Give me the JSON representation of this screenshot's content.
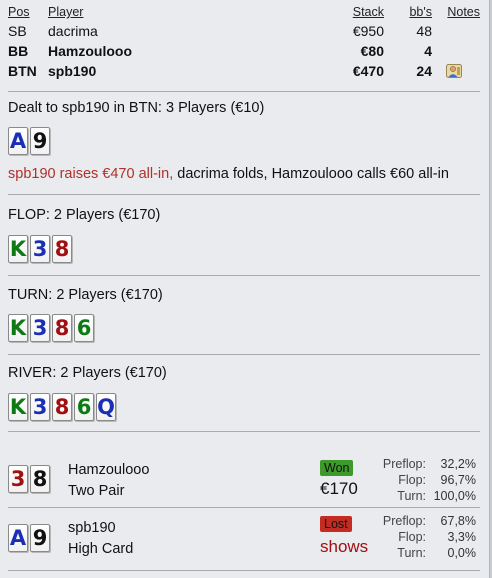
{
  "players": {
    "headers": {
      "pos": "Pos",
      "player": "Player",
      "stack": "Stack",
      "bbs": "bb's",
      "notes": "Notes"
    },
    "rows": [
      {
        "pos": "SB",
        "player": "dacrima",
        "stack": "€950",
        "bbs": "48"
      },
      {
        "pos": "BB",
        "player": "Hamzoulooo",
        "stack": "€80",
        "bbs": "4"
      },
      {
        "pos": "BTN",
        "player": "spb190",
        "stack": "€470",
        "bbs": "24",
        "notes_icon": "notes-user-icon"
      }
    ]
  },
  "preflop": {
    "title": "Dealt to spb190 in BTN: 3 Players (€10)",
    "cards": [
      {
        "rank": "A",
        "suit": "diamonds"
      },
      {
        "rank": "9",
        "suit": "spades"
      }
    ],
    "action_raise": "spb190 raises €470 all-in,",
    "action_rest": " dacrima folds, Hamzoulooo calls €60 all-in"
  },
  "flop": {
    "title": "FLOP: 2 Players (€170)",
    "cards": [
      {
        "rank": "K",
        "suit": "clubs"
      },
      {
        "rank": "3",
        "suit": "diamonds"
      },
      {
        "rank": "8",
        "suit": "hearts"
      }
    ]
  },
  "turn": {
    "title": "TURN: 2 Players (€170)",
    "cards": [
      {
        "rank": "K",
        "suit": "clubs"
      },
      {
        "rank": "3",
        "suit": "diamonds"
      },
      {
        "rank": "8",
        "suit": "hearts"
      },
      {
        "rank": "6",
        "suit": "clubs"
      }
    ]
  },
  "river": {
    "title": "RIVER: 2 Players (€170)",
    "cards": [
      {
        "rank": "K",
        "suit": "clubs"
      },
      {
        "rank": "3",
        "suit": "diamonds"
      },
      {
        "rank": "8",
        "suit": "hearts"
      },
      {
        "rank": "6",
        "suit": "clubs"
      },
      {
        "rank": "Q",
        "suit": "diamonds"
      }
    ]
  },
  "results": [
    {
      "player": "Hamzoulooo",
      "hand": "Two Pair",
      "cards": [
        {
          "rank": "3",
          "suit": "hearts"
        },
        {
          "rank": "8",
          "suit": "spades"
        }
      ],
      "badge": "Won",
      "amount": "€170",
      "stats": [
        {
          "label": "Preflop:",
          "value": "32,2%"
        },
        {
          "label": "Flop:",
          "value": "96,7%"
        },
        {
          "label": "Turn:",
          "value": "100,0%"
        }
      ]
    },
    {
      "player": "spb190",
      "hand": "High Card",
      "cards": [
        {
          "rank": "A",
          "suit": "diamonds"
        },
        {
          "rank": "9",
          "suit": "spades"
        }
      ],
      "badge": "Lost",
      "amount": "shows",
      "stats": [
        {
          "label": "Preflop:",
          "value": "67,8%"
        },
        {
          "label": "Flop:",
          "value": "3,3%"
        },
        {
          "label": "Turn:",
          "value": "0,0%"
        }
      ]
    }
  ],
  "colors": {
    "hearts": "#a01010",
    "diamonds": "#1a2fb5",
    "clubs": "#0d7a14",
    "spades": "#111111",
    "won_badge": "#3c9a2a",
    "lost_badge": "#c42b22",
    "raise_text": "#b0302a",
    "background": "#e9ebee"
  }
}
